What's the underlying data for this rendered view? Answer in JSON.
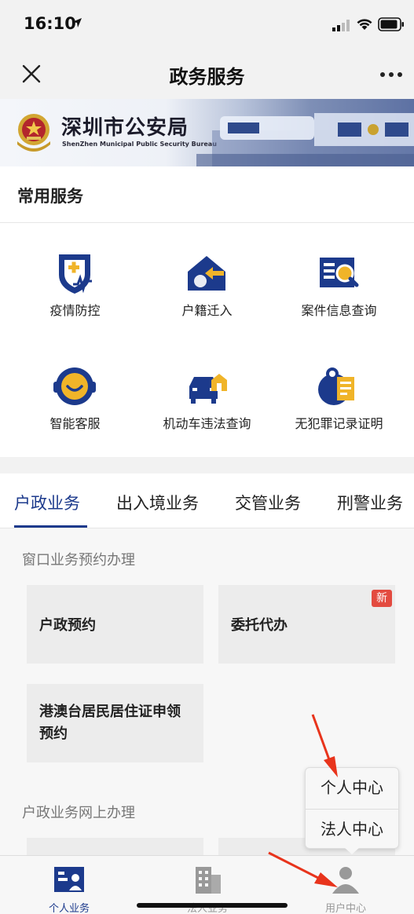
{
  "status_bar": {
    "time": "16:10"
  },
  "nav": {
    "title": "政务服务"
  },
  "banner": {
    "title": "深圳市公安局",
    "subtitle": "ShenZhen Municipal Public Security Bureau"
  },
  "common_services": {
    "title": "常用服务",
    "items": [
      {
        "label": "疫情防控",
        "icon": "shield-plus-icon"
      },
      {
        "label": "户籍迁入",
        "icon": "house-arrow-icon"
      },
      {
        "label": "案件信息查询",
        "icon": "book-search-icon"
      },
      {
        "label": "智能客服",
        "icon": "customer-service-icon"
      },
      {
        "label": "机动车违法查询",
        "icon": "car-house-icon"
      },
      {
        "label": "无犯罪记录证明",
        "icon": "certificate-icon"
      }
    ]
  },
  "tabs": [
    {
      "label": "户政业务",
      "active": true
    },
    {
      "label": "出入境业务",
      "active": false
    },
    {
      "label": "交管业务",
      "active": false
    },
    {
      "label": "刑警业务",
      "active": false
    }
  ],
  "groups": {
    "window": {
      "title": "窗口业务预约办理",
      "cards": [
        {
          "label": "户政预约"
        },
        {
          "label": "委托代办",
          "badge": "新"
        },
        {
          "label": "港澳台居民居住证申领预约"
        }
      ]
    },
    "online": {
      "title": "户政业务网上办理"
    }
  },
  "popup_menu": {
    "items": [
      "个人中心",
      "法人中心"
    ]
  },
  "tab_bar": {
    "items": [
      {
        "label": "个人业务",
        "active": true
      },
      {
        "label": "法人业务",
        "active": false
      },
      {
        "label": "用户中心",
        "active": false
      }
    ]
  },
  "colors": {
    "accent": "#1c3a8c",
    "badge": "#e34b40",
    "annotation": "#e8341c"
  }
}
